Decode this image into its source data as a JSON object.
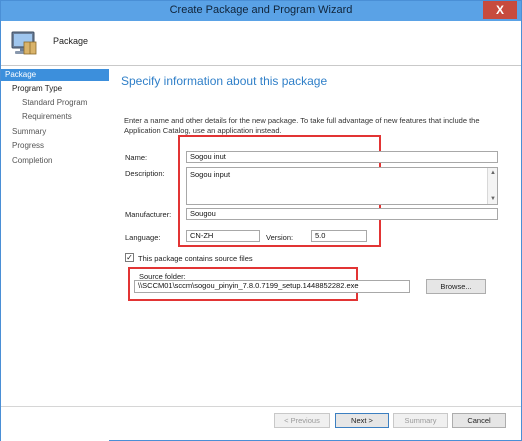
{
  "window": {
    "title": "Create Package and Program Wizard",
    "close_glyph": "X"
  },
  "header": {
    "title": "Package",
    "icon": "computer-package-icon"
  },
  "sidebar": {
    "items": [
      {
        "label": "Package"
      },
      {
        "label": "Program Type"
      },
      {
        "label": "Standard Program"
      },
      {
        "label": "Requirements"
      },
      {
        "label": "Summary"
      },
      {
        "label": "Progress"
      },
      {
        "label": "Completion"
      }
    ]
  },
  "main": {
    "heading": "Specify information about this package",
    "intro": "Enter a name and other details for the new package. To take full advantage of new features that include the Application Catalog, use an application instead.",
    "form": {
      "name_label": "Name:",
      "name_value": "Sogou inut",
      "description_label": "Description:",
      "description_value": "Sogou input",
      "manufacturer_label": "Manufacturer:",
      "manufacturer_value": "Sougou",
      "language_label": "Language:",
      "language_value": "CN-ZH",
      "version_label": "Version:",
      "version_value": "5.0",
      "source_checkbox_label": "This package contains source files",
      "source_checked": true,
      "source_folder_label": "Source folder:",
      "source_folder_value": "\\\\SCCM01\\sccm\\sogou_pinyin_7.8.0.7199_setup.1448852282.exe",
      "browse_label": "Browse..."
    }
  },
  "footer": {
    "previous_label": "< Previous",
    "next_label": "Next >",
    "summary_label": "Summary",
    "cancel_label": "Cancel"
  },
  "colors": {
    "accent": "#3c8fdc",
    "heading": "#2f7fc8",
    "highlight": "#e23434",
    "titlebar": "#5aa2e6"
  }
}
